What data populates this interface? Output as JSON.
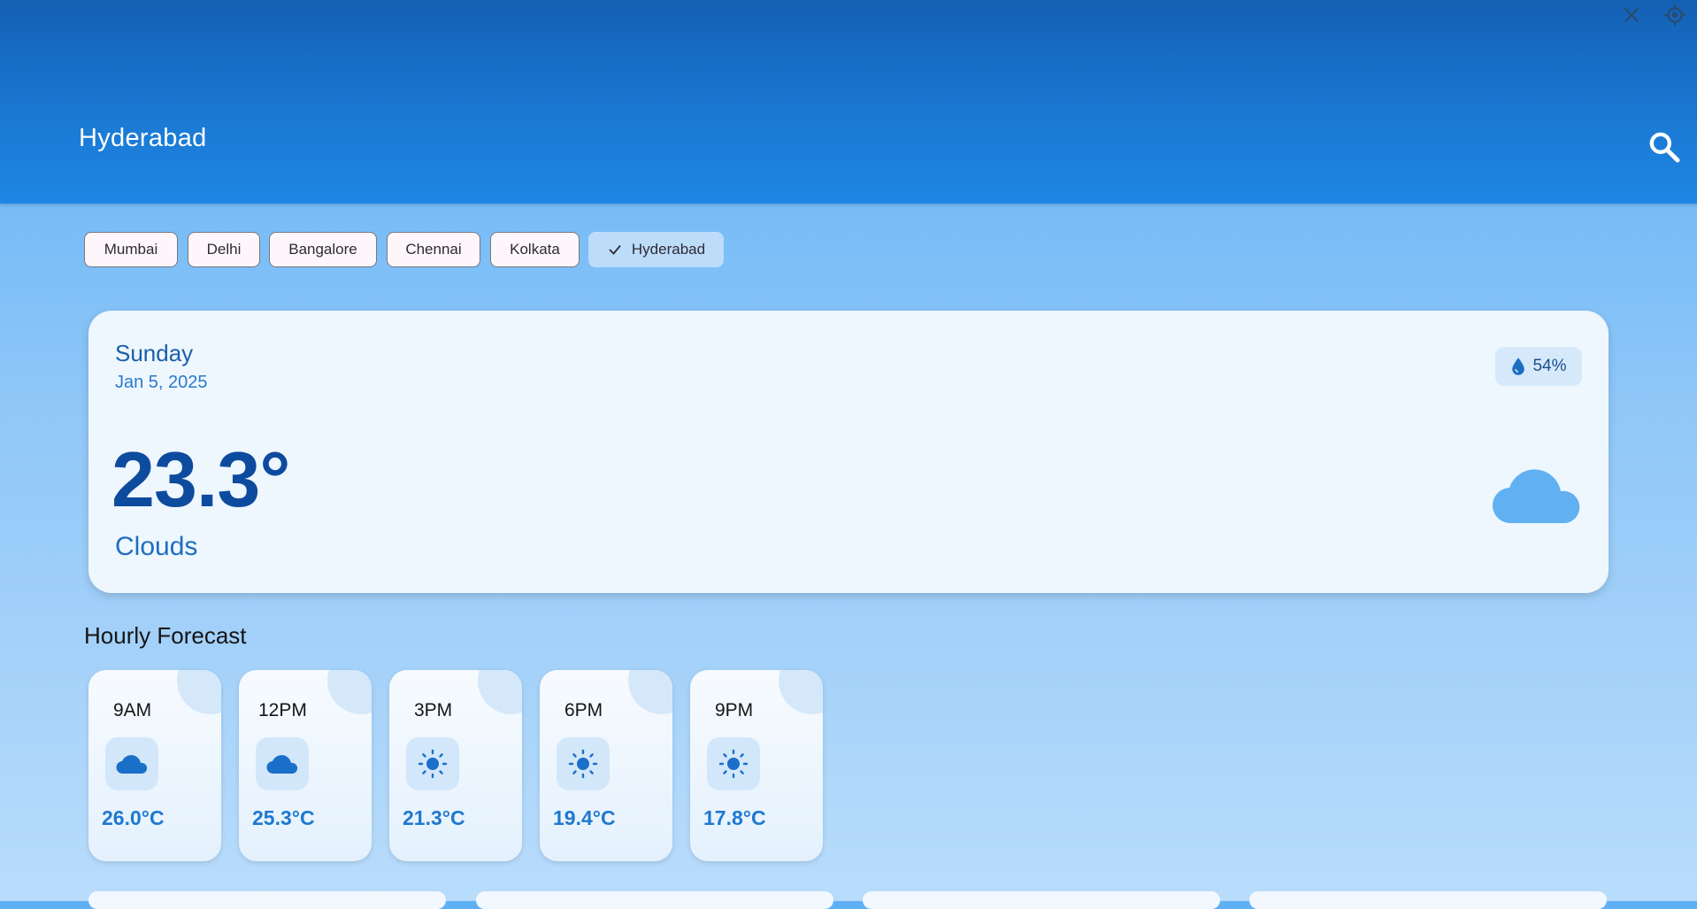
{
  "appbar": {
    "title": "Hyderabad"
  },
  "chips": [
    {
      "label": "Mumbai",
      "selected": false
    },
    {
      "label": "Delhi",
      "selected": false
    },
    {
      "label": "Bangalore",
      "selected": false
    },
    {
      "label": "Chennai",
      "selected": false
    },
    {
      "label": "Kolkata",
      "selected": false
    },
    {
      "label": "Hyderabad",
      "selected": true
    }
  ],
  "current": {
    "day": "Sunday",
    "date": "Jan 5, 2025",
    "temperature": "23.3°",
    "condition": "Clouds",
    "humidity": "54%",
    "icon": "cloud-icon"
  },
  "hourly": {
    "title": "Hourly Forecast",
    "items": [
      {
        "time": "9AM",
        "temp": "26.0°C",
        "icon": "cloud-icon"
      },
      {
        "time": "12PM",
        "temp": "25.3°C",
        "icon": "cloud-icon"
      },
      {
        "time": "3PM",
        "temp": "21.3°C",
        "icon": "sun-icon"
      },
      {
        "time": "6PM",
        "temp": "19.4°C",
        "icon": "sun-icon"
      },
      {
        "time": "9PM",
        "temp": "17.8°C",
        "icon": "sun-icon"
      }
    ]
  },
  "colors": {
    "appbar": "#1a78d2",
    "accent": "#1e78d0",
    "background": "#8fc7f8",
    "card": "#eef6fe"
  }
}
